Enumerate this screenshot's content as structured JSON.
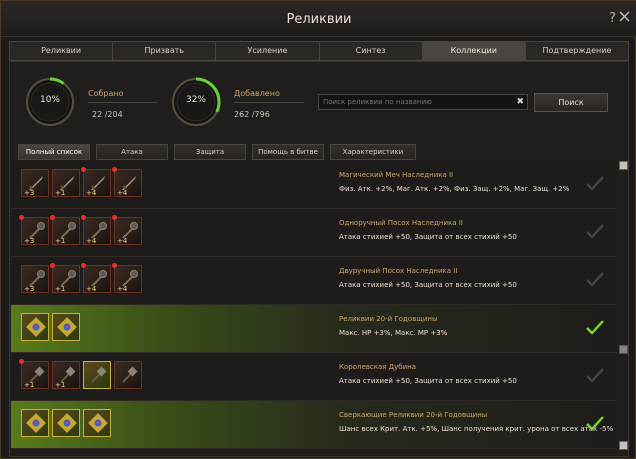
{
  "window": {
    "title": "Реликвии",
    "help": "?"
  },
  "tabs": [
    {
      "label": "Реликвии"
    },
    {
      "label": "Призвать"
    },
    {
      "label": "Усиление"
    },
    {
      "label": "Синтез"
    },
    {
      "label": "Коллекции",
      "active": true
    },
    {
      "label": "Подтверждение"
    }
  ],
  "stats": {
    "collected": {
      "percent_label": "10%",
      "progress": 0.1,
      "label": "Собрано",
      "value": "22 /204"
    },
    "added": {
      "percent_label": "32%",
      "progress": 0.32,
      "label": "Добавлено",
      "value": "262 /796"
    }
  },
  "search": {
    "placeholder": "Поиск реликвии по названию",
    "value": "",
    "clear_icon": "✖",
    "button_label": "Поиск"
  },
  "filters": [
    {
      "label": "Полный список",
      "active": true
    },
    {
      "label": "Атака"
    },
    {
      "label": "Защита"
    },
    {
      "label": "Помощь в битве"
    },
    {
      "label": "Характеристики"
    }
  ],
  "rows": [
    {
      "name": "Магический Меч Наследника II",
      "effect": "Физ. Атк. +2%, Маг. Атк. +2%, Физ. Защ. +2%, Маг. Защ. +2%",
      "complete": false,
      "items": [
        {
          "level": "+3",
          "dot": false,
          "icon": "sword-icon"
        },
        {
          "level": "+1",
          "dot": false,
          "icon": "sword-icon"
        },
        {
          "level": "+4",
          "dot": true,
          "icon": "sword-icon"
        },
        {
          "level": "+4",
          "dot": true,
          "icon": "sword-icon"
        }
      ]
    },
    {
      "name": "Одноручный Посох Наследника II",
      "effect": "Атака стихией +50, Защита от всех стихий +50",
      "complete": false,
      "items": [
        {
          "level": "+3",
          "dot": true,
          "icon": "staff-icon"
        },
        {
          "level": "+1",
          "dot": true,
          "icon": "staff-icon"
        },
        {
          "level": "+4",
          "dot": true,
          "icon": "staff-icon"
        },
        {
          "level": "+4",
          "dot": true,
          "icon": "staff-icon"
        }
      ]
    },
    {
      "name": "Двуручный Посох Наследника II",
      "effect": "Атака стихией +50, Защита от всех стихий +50",
      "complete": false,
      "items": [
        {
          "level": "+3",
          "dot": false,
          "icon": "staff-icon"
        },
        {
          "level": "+1",
          "dot": true,
          "icon": "staff-icon"
        },
        {
          "level": "+4",
          "dot": true,
          "icon": "staff-icon"
        },
        {
          "level": "+4",
          "dot": true,
          "icon": "staff-icon"
        }
      ]
    },
    {
      "name": "Реликвии 20-й Годовщины",
      "effect": "Макс. HP +3%, Макс. MP +3%",
      "complete": true,
      "items": [
        {
          "level": "",
          "dot": false,
          "icon": "gem-relic-icon",
          "unlocked": true
        },
        {
          "level": "",
          "dot": false,
          "icon": "gem-relic-icon",
          "unlocked": true
        }
      ]
    },
    {
      "name": "Королевская Дубина",
      "effect": "Атака стихией +50, Защита от всех стихий +50",
      "complete": false,
      "items": [
        {
          "level": "+1",
          "dot": true,
          "icon": "club-icon"
        },
        {
          "level": "+1",
          "dot": false,
          "icon": "club-icon"
        },
        {
          "level": "",
          "dot": false,
          "icon": "club-icon",
          "unlocked": true
        },
        {
          "level": "",
          "dot": false,
          "icon": "club-icon"
        }
      ]
    },
    {
      "name": "Сверкающие Реликвии 20-й Годовщины",
      "effect": "Шанс всех Крит. Атк. +5%, Шанс получения крит. урона от всех атак -5%",
      "complete": true,
      "items": [
        {
          "level": "",
          "dot": false,
          "icon": "gem-relic-icon",
          "unlocked": true
        },
        {
          "level": "",
          "dot": false,
          "icon": "gem-relic-icon",
          "unlocked": true
        },
        {
          "level": "",
          "dot": false,
          "icon": "gem-relic-icon",
          "unlocked": true
        }
      ]
    }
  ],
  "colors": {
    "accent_green": "#6ccf3a",
    "check_done": "#7ad830",
    "check_pending": "#4a4540",
    "gold_label": "#c8a86a"
  }
}
